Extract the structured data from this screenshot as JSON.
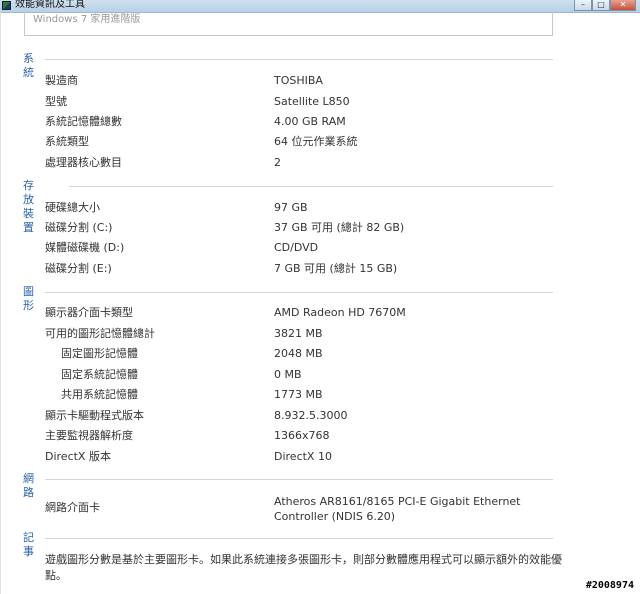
{
  "window": {
    "title": "效能資訊及工具",
    "os_edition": "Windows 7 家用進階版"
  },
  "sections": {
    "system": {
      "title": "系統",
      "rows": [
        {
          "label": "製造商",
          "value": "TOSHIBA"
        },
        {
          "label": "型號",
          "value": "Satellite L850"
        },
        {
          "label": "系統記憶體總數",
          "value": "4.00 GB RAM"
        },
        {
          "label": "系統類型",
          "value": "64 位元作業系統"
        },
        {
          "label": "處理器核心數目",
          "value": "2"
        }
      ]
    },
    "storage": {
      "title": "存放裝置",
      "rows": [
        {
          "label": "硬碟總大小",
          "value": "97 GB"
        },
        {
          "label": "磁碟分割 (C:)",
          "value": "37 GB 可用 (總計 82 GB)"
        },
        {
          "label": "媒體磁碟機 (D:)",
          "value": "CD/DVD"
        },
        {
          "label": "磁碟分割 (E:)",
          "value": "7 GB 可用 (總計 15 GB)"
        }
      ]
    },
    "graphics": {
      "title": "圖形",
      "rows": [
        {
          "label": "顯示器介面卡類型",
          "value": "AMD Radeon HD 7670M"
        },
        {
          "label": "可用的圖形記憶體總計",
          "value": "3821 MB"
        },
        {
          "label": "固定圖形記憶體",
          "value": "2048 MB"
        },
        {
          "label": "固定系統記憶體",
          "value": "0 MB"
        },
        {
          "label": "共用系統記憶體",
          "value": "1773 MB"
        },
        {
          "label": "顯示卡驅動程式版本",
          "value": "8.932.5.3000"
        },
        {
          "label": "主要監視器解析度",
          "value": "1366x768"
        },
        {
          "label": "DirectX 版本",
          "value": "DirectX 10"
        }
      ]
    },
    "network": {
      "title": "網路",
      "rows": [
        {
          "label": "網路介面卡",
          "value": "Atheros AR8161/8165 PCI-E Gigabit Ethernet Controller (NDIS 6.20)"
        }
      ]
    },
    "notes": {
      "title": "記事",
      "text": "遊戲圖形分數是基於主要圖形卡。如果此系統連接多張圖形卡，則部分數體應用程式可以顯示額外的效能優點。"
    }
  },
  "watermark": "#2008974",
  "colors": {
    "section_header": "#2a62a8",
    "rule": "#cfd7e0",
    "titlebar": "#c3d7ea"
  },
  "icons": {
    "app": "performance-info-icon",
    "minimize": "minimize-icon",
    "maximize": "maximize-icon",
    "close": "close-icon"
  }
}
